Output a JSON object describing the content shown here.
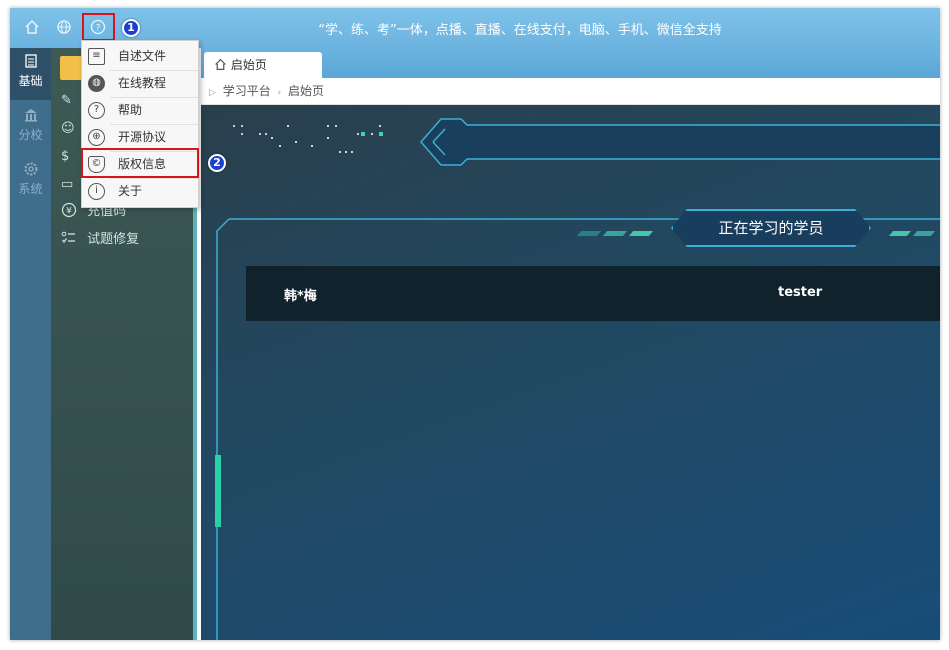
{
  "topbar": {
    "slogan": "“学、练、考”一体，点播、直播、在线支付，电脑、手机、微信全支持",
    "home_icon": "home-icon",
    "globe_icon": "globe-icon",
    "help_icon": "help-icon"
  },
  "annotations": {
    "step1": "1",
    "step2": "2"
  },
  "rail": {
    "items": [
      {
        "label": "基础",
        "icon": "doc-list-icon",
        "active": true
      },
      {
        "label": "分校",
        "icon": "bank-icon",
        "active": false
      },
      {
        "label": "系统",
        "icon": "gear-icon",
        "active": false
      }
    ]
  },
  "sidebar": {
    "items": [
      {
        "label": "充值码",
        "icon": "yuan-circle-icon"
      },
      {
        "label": "试题修复",
        "icon": "checklist-icon"
      }
    ]
  },
  "help_menu": {
    "items": [
      {
        "label": "自述文件",
        "icon": "document-icon"
      },
      {
        "label": "在线教程",
        "icon": "globe-dark-icon"
      },
      {
        "label": "帮助",
        "icon": "question-icon"
      },
      {
        "label": "开源协议",
        "icon": "globe-icon"
      },
      {
        "label": "版权信息",
        "icon": "copyright-shield-icon"
      },
      {
        "label": "关于",
        "icon": "info-icon"
      }
    ]
  },
  "tabs": [
    {
      "label": "启始页",
      "icon": "home-icon"
    }
  ],
  "breadcrumb": {
    "items": [
      "学习平台",
      "启始页"
    ]
  },
  "dashboard": {
    "banner_title": "正在学习的学员",
    "students": [
      "韩*梅",
      "tester"
    ]
  },
  "colors": {
    "topbar": "#6cb3df",
    "rail": "#3f6e8c",
    "sidebar": "#3e5a55",
    "accent_tab": "#f2c046",
    "highlight": "#d9141a",
    "badge": "#1b3fd0",
    "dash": "#22485f"
  }
}
